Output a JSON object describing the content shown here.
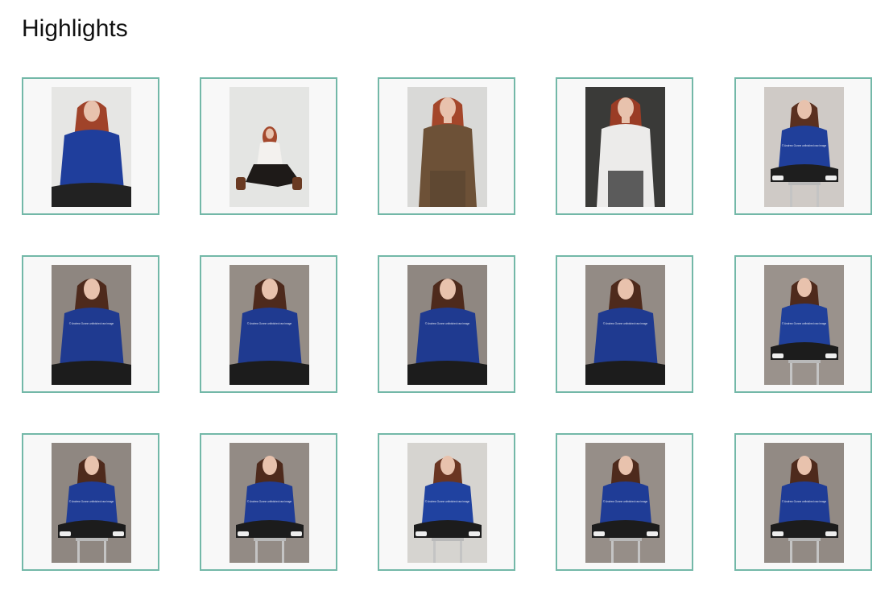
{
  "page": {
    "title": "Highlights"
  },
  "gallery": {
    "columns": 5,
    "items": [
      {
        "alt": "Portrait in blue sweater sitting",
        "backdrop": "#e6e6e4",
        "top": "#1f3e9c",
        "bottom": "#222222",
        "hair": "#a0432a",
        "pose": "sit",
        "watermark": ""
      },
      {
        "alt": "Seated in white shirt and brown boots",
        "backdrop": "#e4e5e3",
        "top": "#f3f1ee",
        "bottom": "#1e1a18",
        "hair": "#a4482c",
        "pose": "floor",
        "watermark": ""
      },
      {
        "alt": "Standing in plaid blazer",
        "backdrop": "#d9d9d7",
        "top": "#6d5137",
        "bottom": "#5a4430",
        "hair": "#a4462a",
        "pose": "stand",
        "watermark": ""
      },
      {
        "alt": "Dark backdrop, white shirt",
        "backdrop": "#3a3a38",
        "top": "#ecebea",
        "bottom": "#1e1e1e",
        "hair": "#9a3c25",
        "pose": "stand",
        "watermark": ""
      },
      {
        "alt": "Blue sweater on stool",
        "backdrop": "#cfcac6",
        "top": "#203f9a",
        "bottom": "#1e1e1e",
        "hair": "#5a3020",
        "pose": "stool",
        "watermark": "© Andrew Gunne unfinished raw image"
      },
      {
        "alt": "Blue sweater portrait",
        "backdrop": "#8e8680",
        "top": "#1f3a90",
        "bottom": "#1c1c1c",
        "hair": "#4e2a1c",
        "pose": "sit",
        "watermark": "© Andrew Gunne unfinished raw image"
      },
      {
        "alt": "Blue sweater portrait",
        "backdrop": "#958d86",
        "top": "#1f3a90",
        "bottom": "#1c1c1c",
        "hair": "#4e2a1c",
        "pose": "sit",
        "watermark": "© Andrew Gunne unfinished raw image"
      },
      {
        "alt": "Blue sweater portrait",
        "backdrop": "#8f8781",
        "top": "#1f3a90",
        "bottom": "#1c1c1c",
        "hair": "#4e2a1c",
        "pose": "sit",
        "watermark": "© Andrew Gunne unfinished raw image"
      },
      {
        "alt": "Blue sweater portrait",
        "backdrop": "#938b85",
        "top": "#1f3a90",
        "bottom": "#1c1c1c",
        "hair": "#4e2a1c",
        "pose": "sit",
        "watermark": "© Andrew Gunne unfinished raw image"
      },
      {
        "alt": "Blue sweater on stool",
        "backdrop": "#9a928c",
        "top": "#20409a",
        "bottom": "#1c1c1c",
        "hair": "#4e2a1c",
        "pose": "stool",
        "watermark": "© Andrew Gunne unfinished raw image"
      },
      {
        "alt": "Cross-legged on stool",
        "backdrop": "#8f8781",
        "top": "#1f3c96",
        "bottom": "#1c1c1c",
        "hair": "#4e2a1c",
        "pose": "stool",
        "watermark": "© Andrew Gunne unfinished raw image"
      },
      {
        "alt": "Cross-legged on stool",
        "backdrop": "#938b85",
        "top": "#1f3c96",
        "bottom": "#1c1c1c",
        "hair": "#4e2a1c",
        "pose": "stool",
        "watermark": "© Andrew Gunne unfinished raw image"
      },
      {
        "alt": "Cross-legged on stool, light backdrop",
        "backdrop": "#d6d4d0",
        "top": "#2042a0",
        "bottom": "#1c1c1c",
        "hair": "#6a3522",
        "pose": "stool",
        "watermark": "© Andrew Gunne unfinished raw image"
      },
      {
        "alt": "Cross-legged on stool",
        "backdrop": "#968e88",
        "top": "#1f3c96",
        "bottom": "#1c1c1c",
        "hair": "#4e2a1c",
        "pose": "stool",
        "watermark": "© Andrew Gunne unfinished raw image"
      },
      {
        "alt": "Cross-legged on stool",
        "backdrop": "#928a84",
        "top": "#1f3c96",
        "bottom": "#1c1c1c",
        "hair": "#4e2a1c",
        "pose": "stool",
        "watermark": "© Andrew Gunne unfinished raw image"
      }
    ]
  },
  "colors": {
    "tile_border": "#73b8a8",
    "tile_bg": "#f8f8f8"
  }
}
